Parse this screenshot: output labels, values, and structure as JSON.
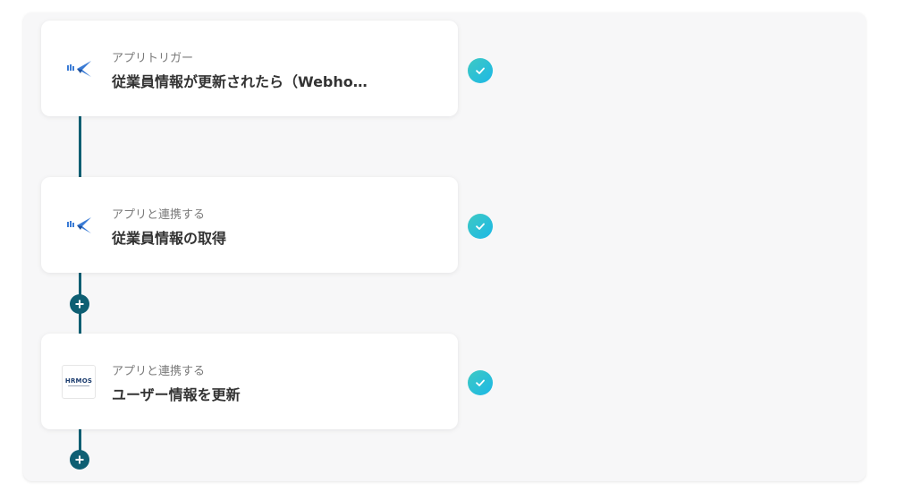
{
  "steps": [
    {
      "label": "アプリトリガー",
      "title": "従業員情報が更新されたら（Webho…",
      "icon": "plane-app-icon",
      "status": "completed"
    },
    {
      "label": "アプリと連携する",
      "title": "従業員情報の取得",
      "icon": "plane-app-icon",
      "status": "completed"
    },
    {
      "label": "アプリと連携する",
      "title": "ユーザー情報を更新",
      "icon": "hrmos-logo",
      "logo_text": "HRMOS",
      "status": "completed"
    }
  ],
  "colors": {
    "connector": "#0e5f73",
    "check_start": "#3ec9c3",
    "check_end": "#1cb8e6",
    "plane_blue": "#3a7bd5"
  }
}
